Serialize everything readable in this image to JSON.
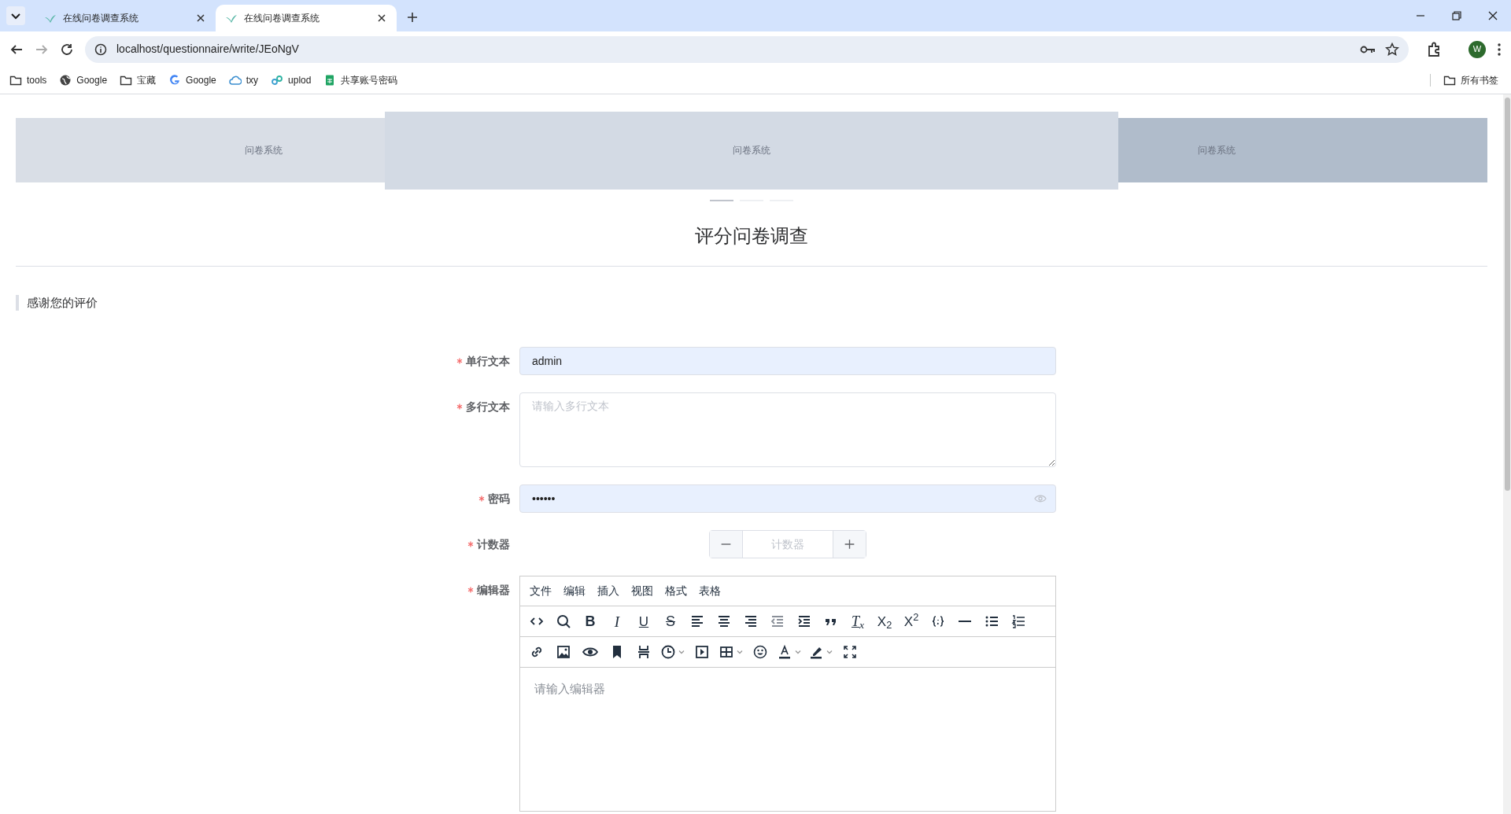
{
  "browser": {
    "tabs": [
      {
        "title": "在线问卷调查系统",
        "selected": false
      },
      {
        "title": "在线问卷调查系统",
        "selected": true
      }
    ],
    "url": "localhost/questionnaire/write/JEoNgV",
    "bookmarks": [
      {
        "label": "tools",
        "kind": "folder"
      },
      {
        "label": "Google",
        "kind": "globe"
      },
      {
        "label": "宝藏",
        "kind": "folder"
      },
      {
        "label": "Google",
        "kind": "google"
      },
      {
        "label": "txy",
        "kind": "cloud"
      },
      {
        "label": "uplod",
        "kind": "link"
      },
      {
        "label": "共享账号密码",
        "kind": "sheet"
      }
    ],
    "all_bookmarks": "所有书签",
    "profile": "W"
  },
  "carousel": {
    "slides": [
      {
        "label": "问卷系统",
        "selected": false
      },
      {
        "label": "问卷系统",
        "selected": true
      },
      {
        "label": "问卷系统",
        "selected": false
      }
    ],
    "indicators": [
      {
        "selected": true
      },
      {
        "selected": false
      },
      {
        "selected": false
      }
    ]
  },
  "survey": {
    "title": "评分问卷调查",
    "section": "感谢您的评价",
    "fields": [
      {
        "kind": "text",
        "label": "单行文本",
        "required": true,
        "value": "admin"
      },
      {
        "kind": "textarea",
        "label": "多行文本",
        "required": true,
        "placeholder": "请输入多行文本"
      },
      {
        "kind": "password",
        "label": "密码",
        "required": true,
        "value": "••••••"
      },
      {
        "kind": "counter",
        "label": "计数器",
        "required": true,
        "placeholder": "计数器"
      },
      {
        "kind": "editor",
        "label": "编辑器",
        "required": true,
        "placeholder": "请输入编辑器",
        "menu": [
          "文件",
          "编辑",
          "插入",
          "视图",
          "格式",
          "表格"
        ],
        "toolbar": [
          [
            {
              "kind": "code"
            },
            {
              "kind": "search"
            },
            {
              "kind": "bold",
              "glyph": "B"
            },
            {
              "kind": "italic",
              "glyph": "I"
            },
            {
              "kind": "underline",
              "glyph": "U"
            },
            {
              "kind": "strike",
              "glyph": "S"
            },
            {
              "kind": "align-left"
            },
            {
              "kind": "align-center"
            },
            {
              "kind": "align-right"
            },
            {
              "kind": "outdent"
            },
            {
              "kind": "indent"
            },
            {
              "kind": "quote"
            },
            {
              "kind": "clear",
              "glyph": "T$_{x}$"
            },
            {
              "kind": "script",
              "glyph": "X$_{2}$"
            },
            {
              "kind": "script",
              "glyph": "X$^{2}$"
            },
            {
              "kind": "codesample"
            },
            {
              "kind": "rule"
            },
            {
              "kind": "bullets"
            },
            {
              "kind": "numbers"
            }
          ],
          [
            {
              "kind": "link"
            },
            {
              "kind": "image"
            },
            {
              "kind": "eye"
            },
            {
              "kind": "bookmark"
            },
            {
              "kind": "pagebreak"
            },
            {
              "kind": "clock",
              "dropdown": true
            },
            {
              "kind": "media"
            },
            {
              "kind": "table",
              "dropdown": true
            },
            {
              "kind": "emoji"
            },
            {
              "kind": "textcolor",
              "dropdown": true
            },
            {
              "kind": "highlight",
              "dropdown": true
            },
            {
              "kind": "fullscreen"
            }
          ]
        ]
      }
    ]
  }
}
